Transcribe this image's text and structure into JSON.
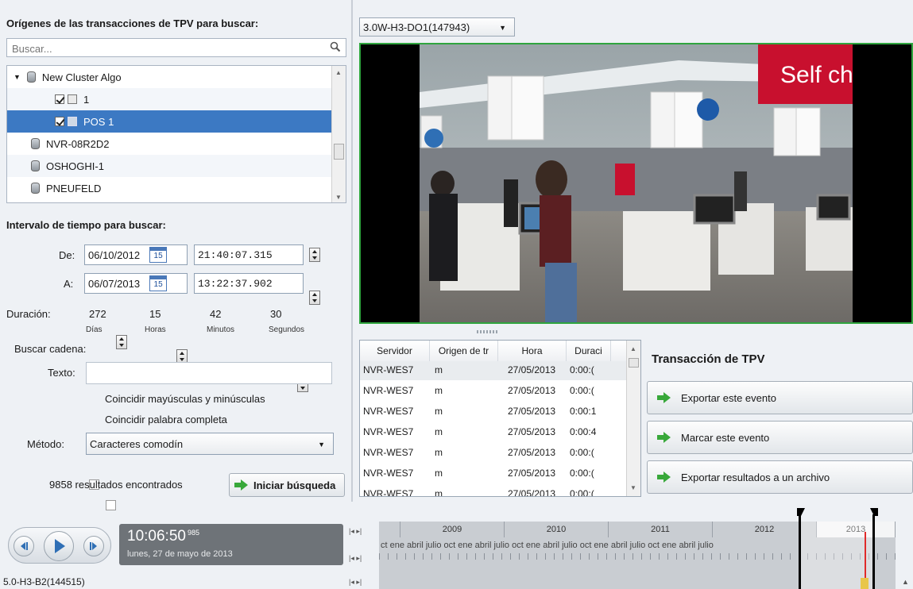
{
  "sources": {
    "heading": "Orígenes de las transacciones de TPV para buscar:",
    "search_placeholder": "Buscar...",
    "tree": [
      {
        "label": "New Cluster Algo"
      },
      {
        "label": "1"
      },
      {
        "label": "POS 1"
      },
      {
        "label": "NVR-08R2D2"
      },
      {
        "label": "OSHOGHI-1"
      },
      {
        "label": "PNEUFELD"
      }
    ]
  },
  "interval": {
    "heading": "Intervalo de tiempo para buscar:",
    "from_label": "De:",
    "from_date": "06/10/2012",
    "from_time": "21:40:07.315",
    "to_label": "A:",
    "to_date": "06/07/2013",
    "to_time": "13:22:37.902",
    "calendar_day": "15",
    "duration_label": "Duración:",
    "days": "272",
    "hours": "15",
    "minutes": "42",
    "seconds": "30",
    "days_label": "Días",
    "hours_label": "Horas",
    "minutes_label": "Minutos",
    "seconds_label": "Segundos"
  },
  "search_string": {
    "heading": "Buscar cadena:",
    "text_label": "Texto:",
    "text_value": "",
    "match_case": "Coincidir mayúsculas y minúsculas",
    "match_word": "Coincidir palabra completa",
    "method_label": "Método:",
    "method_value": "Caracteres comodín"
  },
  "results": {
    "count_text": "9858 resultados encontrados",
    "start_button": "Iniciar búsqueda"
  },
  "camera_select": "3.0W-H3-DO1(147943)",
  "video_overlay_text": "Self ch",
  "table": {
    "columns": [
      "Servidor",
      "Origen de tr",
      "Hora",
      "Duraci"
    ],
    "rows": [
      [
        "NVR-WES7",
        "m",
        "27/05/2013",
        "0:00:("
      ],
      [
        "NVR-WES7",
        "m",
        "27/05/2013",
        "0:00:("
      ],
      [
        "NVR-WES7",
        "m",
        "27/05/2013",
        "0:00:1"
      ],
      [
        "NVR-WES7",
        "m",
        "27/05/2013",
        "0:00:4"
      ],
      [
        "NVR-WES7",
        "m",
        "27/05/2013",
        "0:00:("
      ],
      [
        "NVR-WES7",
        "m",
        "27/05/2013",
        "0:00:("
      ],
      [
        "NVR-WES7",
        "m",
        "27/05/2013",
        "0:00:("
      ]
    ]
  },
  "transaction": {
    "title": "Transacción de TPV",
    "export_event": "Exportar este evento",
    "mark_event": "Marcar este evento",
    "export_results": "Exportar resultados a un archivo"
  },
  "player": {
    "time": "10:06:50",
    "ms": "985",
    "date": "lunes, 27 de mayo de 2013",
    "camera_bottom": "5.0-H3-B2(144515)"
  },
  "timeline": {
    "years": [
      "2009",
      "2010",
      "2011",
      "2012",
      "2013"
    ],
    "months": "ct ene abril julio oct ene abril julio oct ene abril julio oct ene abril julio oct ene abril julio"
  },
  "colors": {
    "selection": "#3c79c3",
    "video_border": "#2fa53e",
    "accent_green": "#38a83a"
  }
}
